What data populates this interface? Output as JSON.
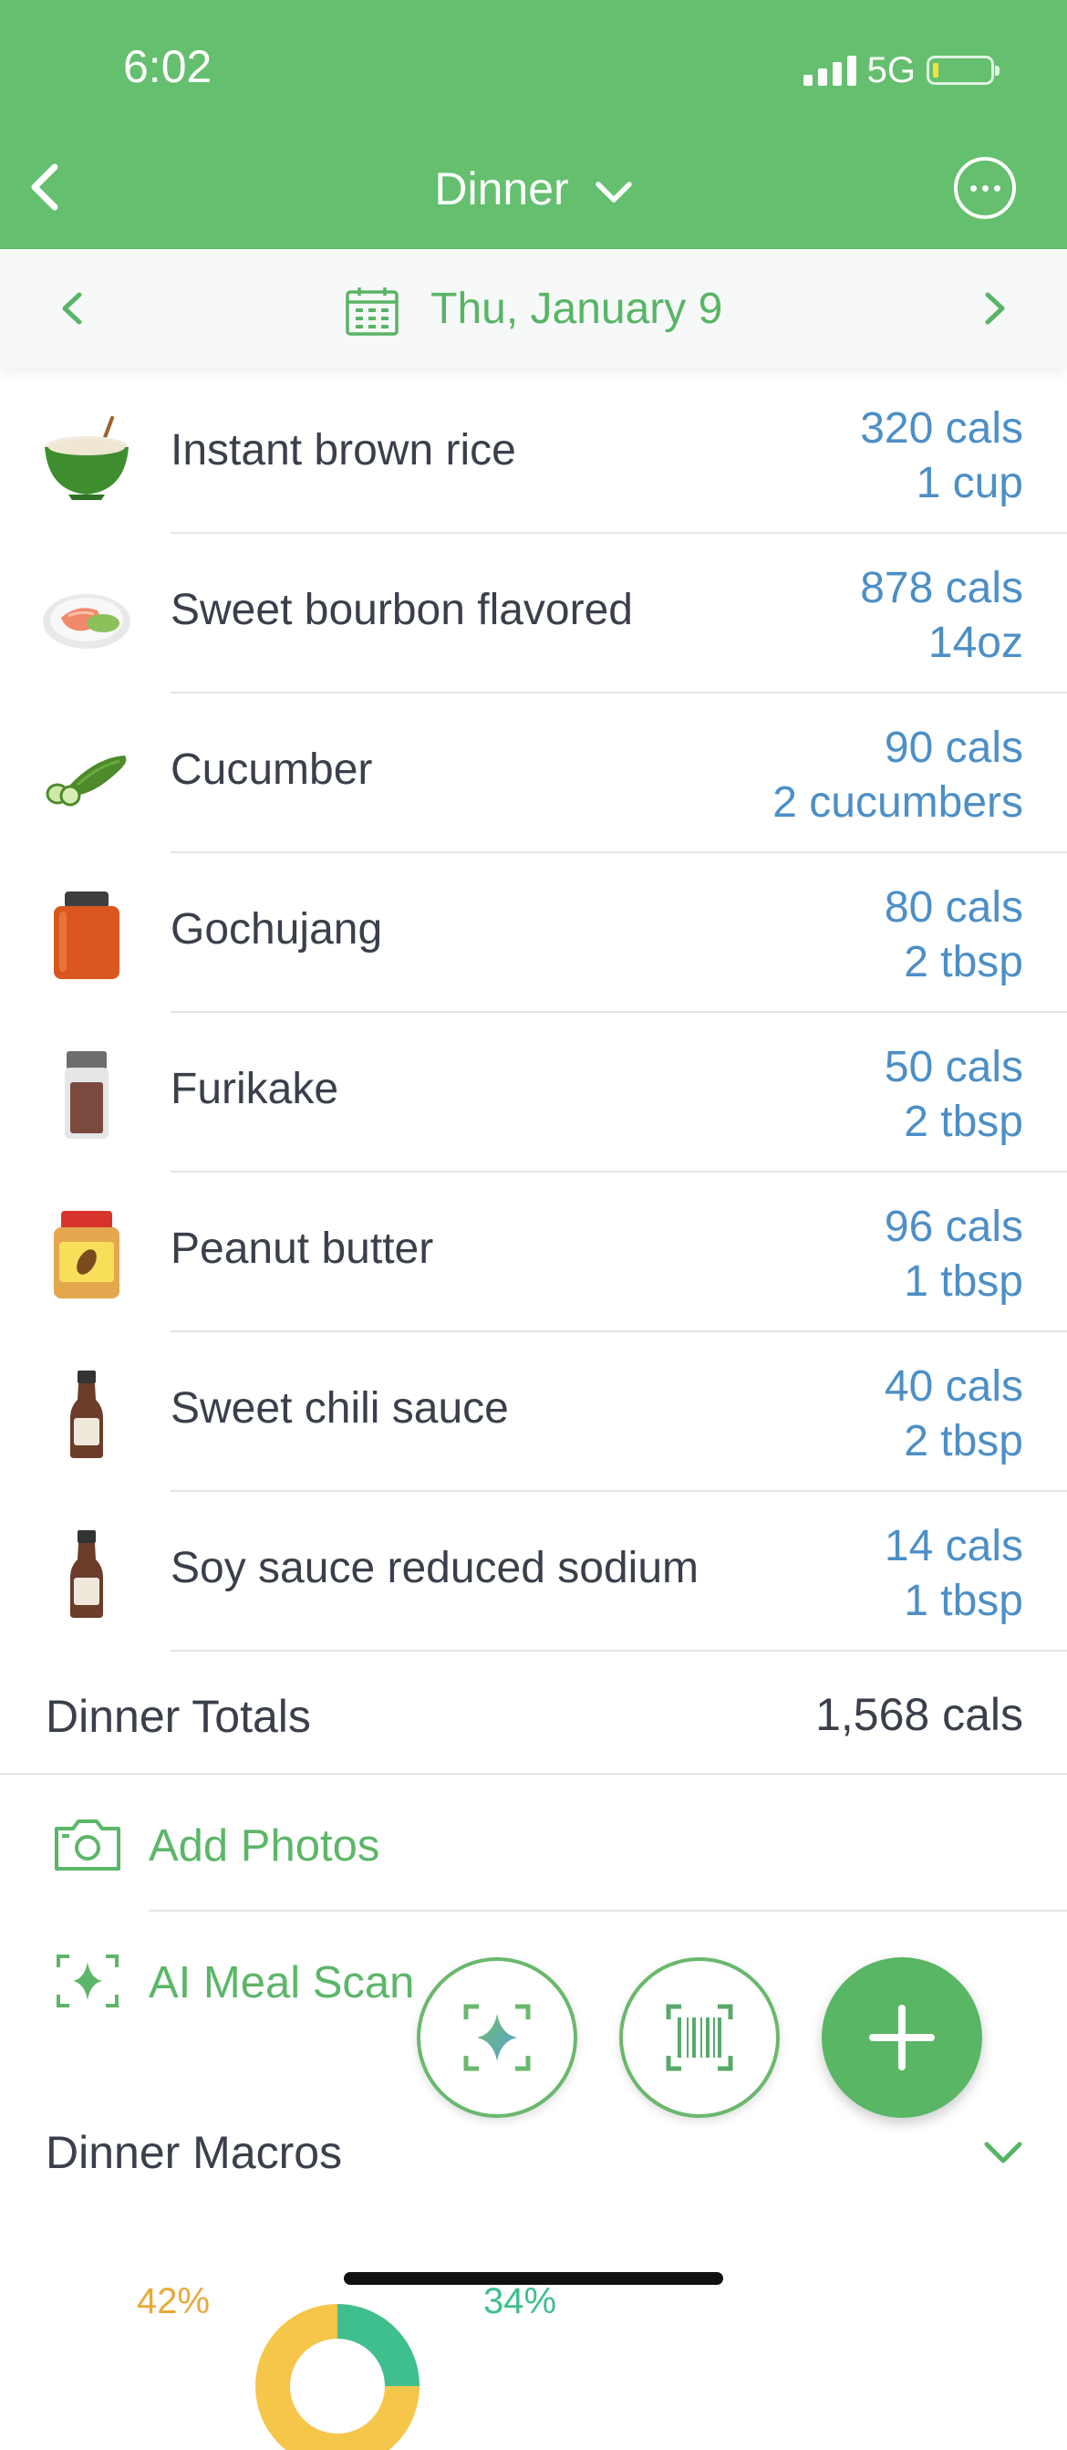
{
  "status": {
    "time": "6:02",
    "network": "5G"
  },
  "header": {
    "title": "Dinner"
  },
  "date": {
    "label": "Thu, January 9"
  },
  "foods": [
    {
      "name": "Instant brown rice",
      "cals": "320 cals",
      "serving": "1 cup",
      "icon": "rice-bowl-icon"
    },
    {
      "name": "Sweet bourbon flavored",
      "cals": "878 cals",
      "serving": "14oz",
      "icon": "salmon-plate-icon"
    },
    {
      "name": "Cucumber",
      "cals": "90 cals",
      "serving": "2 cucumbers",
      "icon": "cucumber-icon"
    },
    {
      "name": "Gochujang",
      "cals": "80 cals",
      "serving": "2 tbsp",
      "icon": "jar-icon"
    },
    {
      "name": "Furikake",
      "cals": "50 cals",
      "serving": "2 tbsp",
      "icon": "spice-shaker-icon"
    },
    {
      "name": "Peanut butter",
      "cals": "96 cals",
      "serving": "1 tbsp",
      "icon": "peanut-butter-jar-icon"
    },
    {
      "name": "Sweet chili sauce",
      "cals": "40 cals",
      "serving": "2 tbsp",
      "icon": "sauce-bottle-icon"
    },
    {
      "name": "Soy sauce reduced sodium",
      "cals": "14 cals",
      "serving": "1 tbsp",
      "icon": "sauce-bottle-icon"
    }
  ],
  "totals": {
    "label": "Dinner Totals",
    "value": "1,568 cals"
  },
  "actions": {
    "add_photos": "Add Photos",
    "ai_meal_scan": "AI Meal Scan"
  },
  "macros": {
    "label": "Dinner Macros",
    "left_pct": "42%",
    "right_pct": "34%"
  },
  "colors": {
    "header_green": "#64bf6e",
    "accent_green": "#58b566",
    "calorie_blue": "#4d8fc6"
  }
}
